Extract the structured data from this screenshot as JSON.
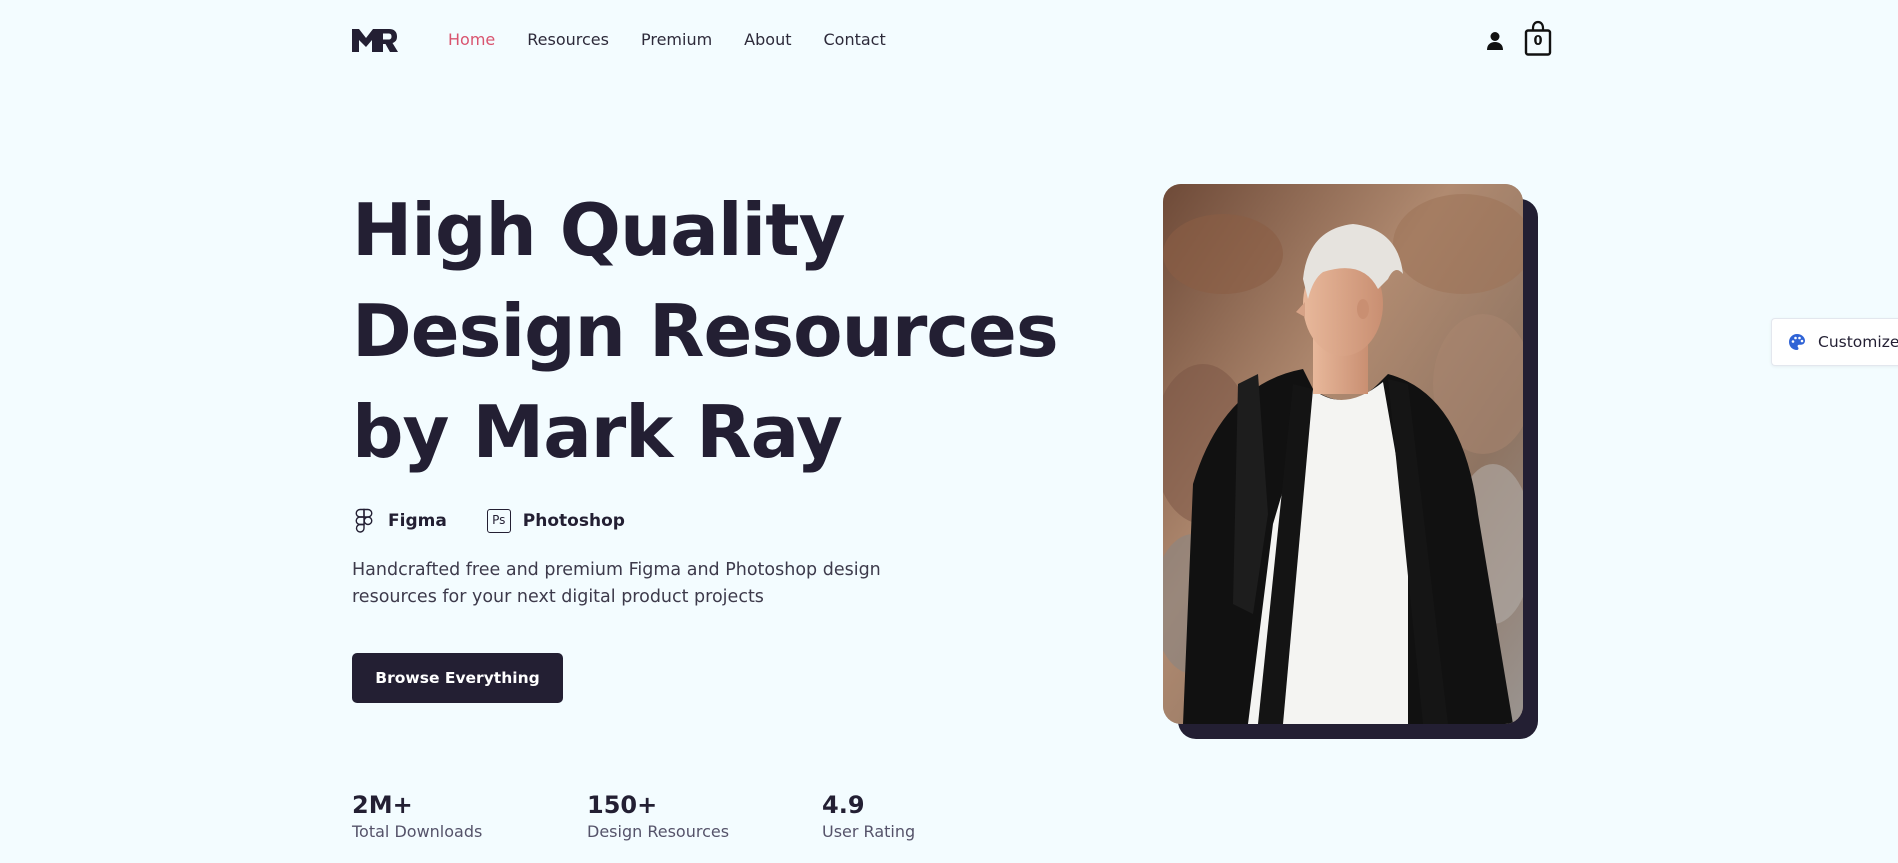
{
  "header": {
    "logo_text": "MR",
    "nav": [
      {
        "label": "Home",
        "active": true
      },
      {
        "label": "Resources",
        "active": false
      },
      {
        "label": "Premium",
        "active": false
      },
      {
        "label": "About",
        "active": false
      },
      {
        "label": "Contact",
        "active": false
      }
    ],
    "cart_count": "0"
  },
  "hero": {
    "title_lines": [
      "High Quality",
      "Design Resources",
      "by Mark Ray"
    ],
    "tools": [
      {
        "icon": "figma-icon",
        "label": "Figma"
      },
      {
        "icon": "photoshop-icon",
        "label": "Photoshop",
        "icon_text": "Ps"
      }
    ],
    "description": "Handcrafted free and premium Figma and Photoshop design resources for your next digital product projects",
    "cta_label": "Browse Everything"
  },
  "stats": [
    {
      "value": "2M+",
      "label": "Total Downloads"
    },
    {
      "value": "150+",
      "label": "Design Resources"
    },
    {
      "value": "4.9",
      "label": "User Rating"
    }
  ],
  "customize": {
    "label": "Customize",
    "icon": "palette-icon"
  },
  "colors": {
    "background": "#f3fcff",
    "primary_dark": "#231f33",
    "accent_active_nav": "#d9546f",
    "customize_icon": "#2f63d6"
  }
}
